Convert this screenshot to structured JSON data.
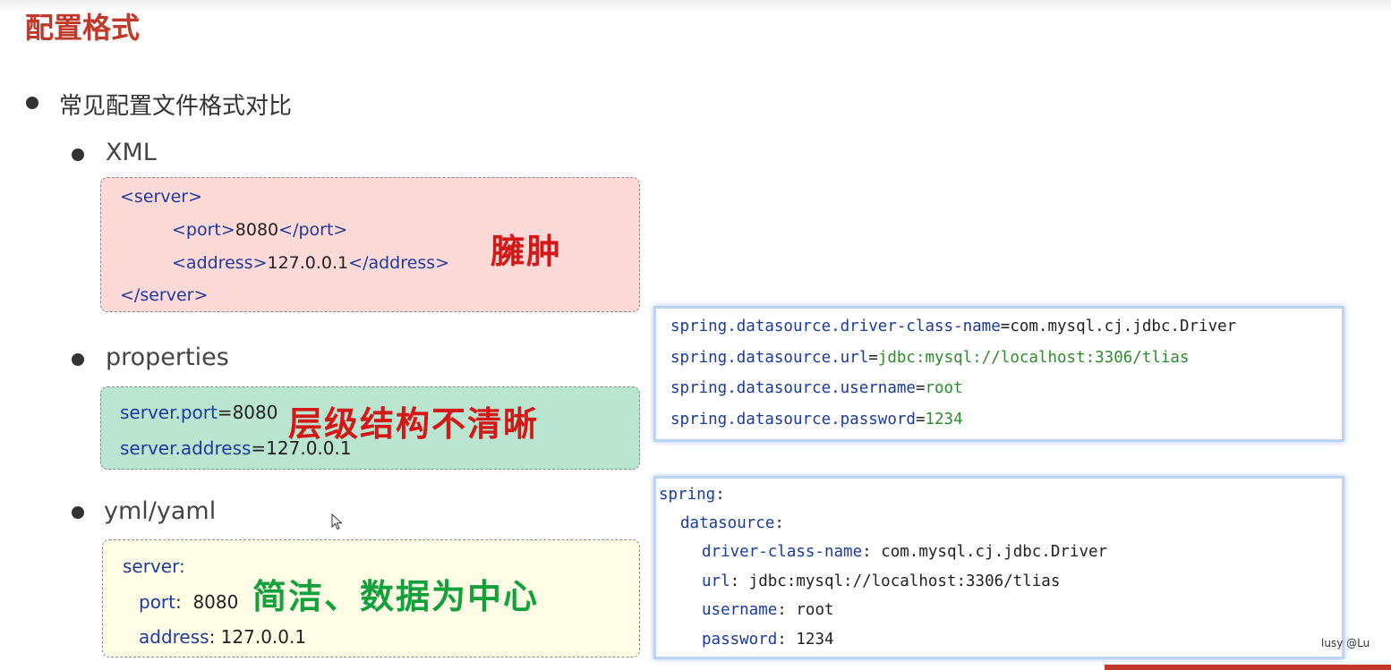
{
  "slide": {
    "title": "配置格式",
    "main_bullet": "常见配置文件格式对比",
    "watermark": "lusy @Lu"
  },
  "xml": {
    "label": "XML",
    "lines": [
      {
        "parts": [
          {
            "t": "<server>",
            "k": true
          }
        ]
      },
      {
        "parts": [
          {
            "t": "<port>",
            "k": true
          },
          {
            "t": "8080",
            "k": false
          },
          {
            "t": "</port>",
            "k": true
          }
        ]
      },
      {
        "parts": [
          {
            "t": "<address>",
            "k": true
          },
          {
            "t": "127.0.0.1",
            "k": false
          },
          {
            "t": "</address>",
            "k": true
          }
        ]
      },
      {
        "parts": [
          {
            "t": "</server>",
            "k": true
          }
        ]
      }
    ],
    "note": "臃肿",
    "bg_color": "#fdd9d7"
  },
  "properties": {
    "label": "properties",
    "lines": [
      {
        "parts": [
          {
            "t": "server.port",
            "k": true
          },
          {
            "t": "=8080",
            "k": false
          }
        ]
      },
      {
        "parts": [
          {
            "t": "server.address",
            "k": true
          },
          {
            "t": "=127.0.0.1",
            "k": false
          }
        ]
      }
    ],
    "note": "层级结构不清晰",
    "bg_color": "#b9e5d1"
  },
  "yml": {
    "label": "yml/yaml",
    "lines": [
      {
        "parts": [
          {
            "t": "server:",
            "k": true
          }
        ]
      },
      {
        "parts": [
          {
            "t": "port",
            "k": true
          },
          {
            "t": ":  8080",
            "k": false
          }
        ]
      },
      {
        "parts": [
          {
            "t": "address",
            "k": true
          },
          {
            "t": ": 127.0.0.1",
            "k": false
          }
        ]
      }
    ],
    "note": "简洁、数据为中心",
    "bg_color": "#fefde5"
  },
  "code_properties": {
    "lines": [
      {
        "parts": [
          {
            "t": "spring.datasource.driver-class-name",
            "c": "k"
          },
          {
            "t": "=",
            "c": "p"
          },
          {
            "t": "com.mysql.cj.jdbc.Driver",
            "c": "p"
          }
        ]
      },
      {
        "parts": [
          {
            "t": "spring.datasource.url",
            "c": "k"
          },
          {
            "t": "=",
            "c": "p"
          },
          {
            "t": "jdbc:mysql://localhost:3306/tlias",
            "c": "v"
          }
        ]
      },
      {
        "parts": [
          {
            "t": "spring.datasource.username",
            "c": "k"
          },
          {
            "t": "=",
            "c": "p"
          },
          {
            "t": "root",
            "c": "v"
          }
        ]
      },
      {
        "parts": [
          {
            "t": "spring.datasource.password",
            "c": "k"
          },
          {
            "t": "=",
            "c": "p"
          },
          {
            "t": "1234",
            "c": "v"
          }
        ]
      }
    ]
  },
  "code_yml": {
    "lines": [
      {
        "parts": [
          {
            "t": "spring",
            "c": "k"
          },
          {
            "t": ":",
            "c": "p"
          }
        ]
      },
      {
        "parts": [
          {
            "t": "datasource",
            "c": "k"
          },
          {
            "t": ":",
            "c": "p"
          }
        ]
      },
      {
        "parts": [
          {
            "t": "driver-class-name",
            "c": "k"
          },
          {
            "t": ": com.mysql.cj.jdbc.Driver",
            "c": "p"
          }
        ]
      },
      {
        "parts": [
          {
            "t": "url",
            "c": "k"
          },
          {
            "t": ": jdbc:mysql://localhost:3306/tlias",
            "c": "p"
          }
        ]
      },
      {
        "parts": [
          {
            "t": "username",
            "c": "k"
          },
          {
            "t": ": root",
            "c": "p"
          }
        ]
      },
      {
        "parts": [
          {
            "t": "password",
            "c": "k"
          },
          {
            "t": ": 1234",
            "c": "p"
          }
        ]
      }
    ]
  },
  "colors": {
    "title": "#c0392b",
    "tag_blue": "#1f3a9e",
    "note_red": "#d41818",
    "note_green": "#14a03c"
  }
}
